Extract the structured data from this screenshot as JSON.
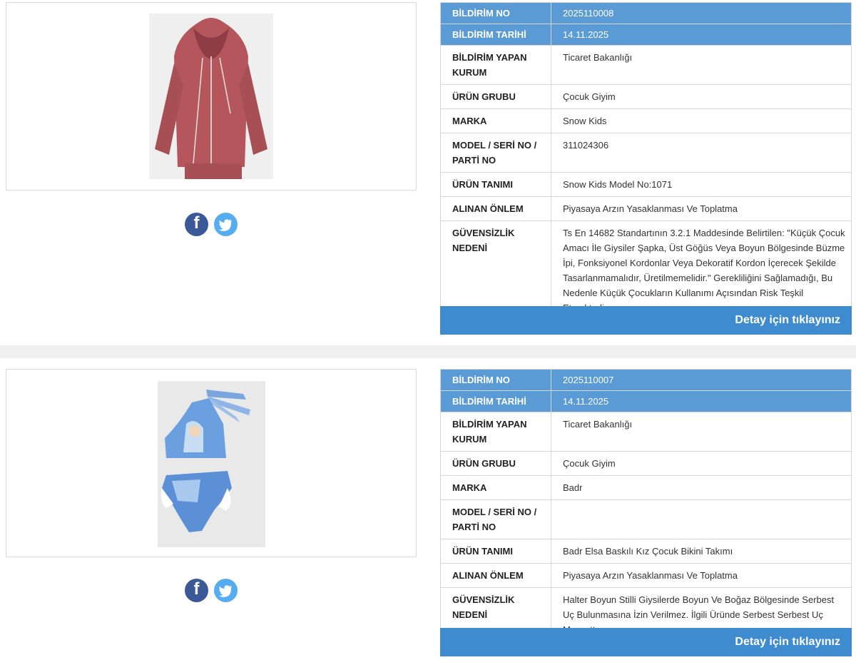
{
  "labels": {
    "bildirim_no": "BİLDİRİM NO",
    "bildirim_tarihi": "BİLDİRİM TARİHİ",
    "bildirim_yapan_kurum": "BİLDİRİM YAPAN KURUM",
    "urun_grubu": "ÜRÜN GRUBU",
    "marka": "MARKA",
    "model_seri": "MODEL / SERİ NO / PARTİ NO",
    "urun_tanimi": "ÜRÜN TANIMI",
    "alinan_onlem": "ALINAN ÖNLEM",
    "guvensizlik_nedeni": "GÜVENSİZLİK NEDENİ"
  },
  "detail_link": "Detay için tıklayınız",
  "records": [
    {
      "bildirim_no": "2025110008",
      "bildirim_tarihi": "14.11.2025",
      "bildirim_yapan_kurum": "Ticaret Bakanlığı",
      "urun_grubu": "Çocuk Giyim",
      "marka": "Snow Kids",
      "model_seri": "311024306",
      "urun_tanimi": "Snow Kids Model No:1071",
      "alinan_onlem": "Piyasaya Arzın Yasaklanması Ve Toplatma",
      "guvensizlik_nedeni": "Ts En 14682 Standartının 3.2.1 Maddesinde Belirtilen: \"Küçük Çocuk Amacı İle Giysiler Şapka, Üst Göğüs Veya Boyun Bölgesinde Büzme İpi, Fonksiyonel Kordonlar Veya Dekoratif Kordon İçerecek Şekilde Tasarlanmamalıdır, Üretilmemelidir.\" Gerekliliğini Sağlamadığı, Bu Nedenle Küçük Çocukların Kullanımı Açısından Risk Teşkil Etmektedir.",
      "photo_colors": {
        "garment": "#b5565c",
        "background": "#efefef"
      }
    },
    {
      "bildirim_no": "2025110007",
      "bildirim_tarihi": "14.11.2025",
      "bildirim_yapan_kurum": "Ticaret Bakanlığı",
      "urun_grubu": "Çocuk Giyim",
      "marka": "Badr",
      "model_seri": "",
      "urun_tanimi": "Badr Elsa Baskılı Kız Çocuk Bikini Takımı",
      "alinan_onlem": "Piyasaya Arzın Yasaklanması Ve Toplatma",
      "guvensizlik_nedeni": "Halter Boyun Stilli Giysilerde Boyun Ve Boğaz Bölgesinde Serbest Uç Bulunmasına İzin Verilmez. İlgili Üründe Serbest Serbest Uç Mevcuttur.",
      "photo_colors": {
        "garment": "#5b8fd6",
        "background": "#e9e9e9"
      }
    }
  ],
  "icons": {
    "facebook": "facebook-icon",
    "twitter": "twitter-icon"
  },
  "colors": {
    "header_row": "#5b9bd5",
    "detail_bar": "#3f8bd0",
    "facebook": "#3b5998",
    "twitter": "#55acee"
  }
}
